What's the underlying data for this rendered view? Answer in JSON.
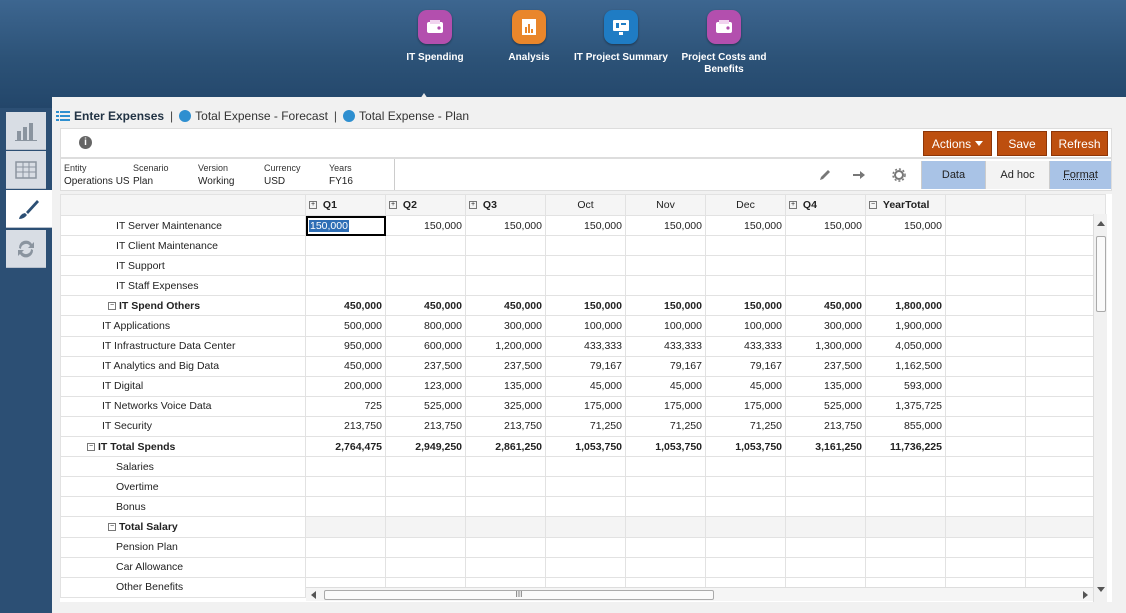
{
  "nav": {
    "cards": [
      {
        "label": "IT Spending",
        "color": "#b34fae",
        "icon": "wallet-icon"
      },
      {
        "label": "Analysis",
        "color": "#e9862b",
        "icon": "report-icon"
      },
      {
        "label": "IT Project Summary",
        "color": "#1f7cc4",
        "icon": "monitor-icon"
      },
      {
        "label": "Project Costs and Benefits",
        "color": "#b34fae",
        "icon": "wallet-icon"
      }
    ]
  },
  "breadcrumb": {
    "form_title": "Enter Expenses",
    "link1": "Total Expense - Forecast",
    "link2": "Total Expense - Plan",
    "separator": "|"
  },
  "toolbar": {
    "info_glyph": "i",
    "actions_label": "Actions",
    "save_label": "Save",
    "refresh_label": "Refresh",
    "accent": "#bd4f0f"
  },
  "pov": {
    "items": [
      {
        "label": "Entity",
        "value": "Operations US"
      },
      {
        "label": "Scenario",
        "value": "Plan"
      },
      {
        "label": "Version",
        "value": "Working"
      },
      {
        "label": "Currency",
        "value": "USD"
      },
      {
        "label": "Years",
        "value": "FY16"
      }
    ],
    "modes": {
      "data": "Data",
      "adhoc": "Ad hoc",
      "format": "Format"
    }
  },
  "grid": {
    "columns": [
      "Q1",
      "Q2",
      "Q3",
      "Oct",
      "Nov",
      "Dec",
      "Q4",
      "YearTotal"
    ],
    "rows": [
      {
        "label": "IT Server Maintenance",
        "indent": 3,
        "values": [
          "150,000",
          "150,000",
          "150,000",
          "150,000",
          "150,000",
          "150,000",
          "150,000",
          "150,000"
        ]
      },
      {
        "label": "IT Client Maintenance",
        "indent": 3,
        "values": [
          "",
          "",
          "",
          "",
          "",
          "",
          "",
          ""
        ]
      },
      {
        "label": "IT Support",
        "indent": 3,
        "values": [
          "",
          "",
          "",
          "",
          "",
          "",
          "",
          ""
        ]
      },
      {
        "label": "IT Staff Expenses",
        "indent": 3,
        "values": [
          "",
          "",
          "",
          "",
          "",
          "",
          "",
          ""
        ]
      },
      {
        "label": "IT Spend Others",
        "indent": 2,
        "bold": true,
        "expand": true,
        "values": [
          "450,000",
          "450,000",
          "450,000",
          "150,000",
          "150,000",
          "150,000",
          "450,000",
          "1,800,000"
        ]
      },
      {
        "label": "IT Applications",
        "indent": 2,
        "values": [
          "500,000",
          "800,000",
          "300,000",
          "100,000",
          "100,000",
          "100,000",
          "300,000",
          "1,900,000"
        ]
      },
      {
        "label": "IT Infrastructure Data Center",
        "indent": 2,
        "values": [
          "950,000",
          "600,000",
          "1,200,000",
          "433,333",
          "433,333",
          "433,333",
          "1,300,000",
          "4,050,000"
        ]
      },
      {
        "label": "IT Analytics and Big Data",
        "indent": 2,
        "values": [
          "450,000",
          "237,500",
          "237,500",
          "79,167",
          "79,167",
          "79,167",
          "237,500",
          "1,162,500"
        ]
      },
      {
        "label": "IT Digital",
        "indent": 2,
        "values": [
          "200,000",
          "123,000",
          "135,000",
          "45,000",
          "45,000",
          "45,000",
          "135,000",
          "593,000"
        ]
      },
      {
        "label": "IT Networks Voice Data",
        "indent": 2,
        "values": [
          "725",
          "525,000",
          "325,000",
          "175,000",
          "175,000",
          "175,000",
          "525,000",
          "1,375,725"
        ]
      },
      {
        "label": "IT Security",
        "indent": 2,
        "values": [
          "213,750",
          "213,750",
          "213,750",
          "71,250",
          "71,250",
          "71,250",
          "213,750",
          "855,000"
        ]
      },
      {
        "label": "IT Total Spends",
        "indent": 1,
        "bold": true,
        "expand": true,
        "values": [
          "2,764,475",
          "2,949,250",
          "2,861,250",
          "1,053,750",
          "1,053,750",
          "1,053,750",
          "3,161,250",
          "11,736,225"
        ]
      },
      {
        "label": "Salaries",
        "indent": 3,
        "values": [
          "",
          "",
          "",
          "",
          "",
          "",
          "",
          ""
        ]
      },
      {
        "label": "Overtime",
        "indent": 3,
        "values": [
          "",
          "",
          "",
          "",
          "",
          "",
          "",
          ""
        ]
      },
      {
        "label": "Bonus",
        "indent": 3,
        "values": [
          "",
          "",
          "",
          "",
          "",
          "",
          "",
          ""
        ]
      },
      {
        "label": "Total Salary",
        "indent": 2,
        "bold": true,
        "expand": true,
        "values": [
          "",
          "",
          "",
          "",
          "",
          "",
          "",
          ""
        ]
      },
      {
        "label": "Pension Plan",
        "indent": 3,
        "values": [
          "",
          "",
          "",
          "",
          "",
          "",
          "",
          ""
        ]
      },
      {
        "label": "Car Allowance",
        "indent": 3,
        "values": [
          "",
          "",
          "",
          "",
          "",
          "",
          "",
          ""
        ]
      },
      {
        "label": "Other Benefits",
        "indent": 3,
        "values": [
          "",
          "",
          "",
          "",
          "",
          "",
          "",
          ""
        ]
      }
    ]
  },
  "scroll": {
    "grip": "III"
  }
}
